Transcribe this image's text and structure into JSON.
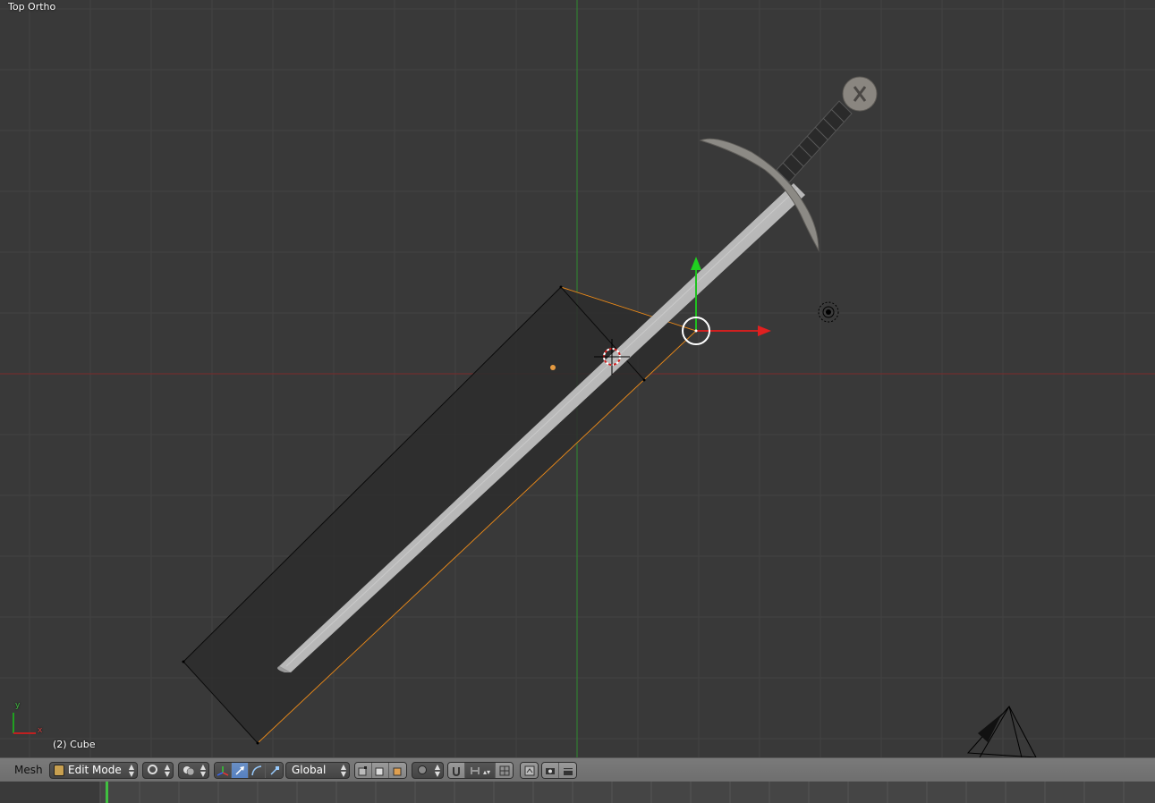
{
  "viewport": {
    "view_label": "Top Ortho",
    "object_label": "(2) Cube",
    "axis_x_label": "x",
    "axis_y_label": "y"
  },
  "header": {
    "menu_mesh": "Mesh",
    "mode": "Edit Mode",
    "orientation": "Global"
  },
  "icons": {
    "mode": "edit-mode-icon",
    "shading": "viewport-shading-icon",
    "pivot": "pivot-point-icon",
    "manipulator": "manipulator-icon",
    "translate": "translate-icon",
    "rotate": "rotate-icon",
    "scale": "scale-icon",
    "select_vertex": "vertex-select-icon",
    "select_edge": "edge-select-icon",
    "select_face": "face-select-icon",
    "proportional": "proportional-edit-icon",
    "snap": "snap-icon",
    "snap_element": "snap-element-icon",
    "render_image": "opengl-render-image-icon",
    "render_anim": "opengl-render-animation-icon"
  },
  "colors": {
    "viewport_bg": "#393939",
    "x_axis": "#a02020",
    "y_axis": "#20a020",
    "selection": "#e58a20",
    "active_button": "#5680c0"
  }
}
